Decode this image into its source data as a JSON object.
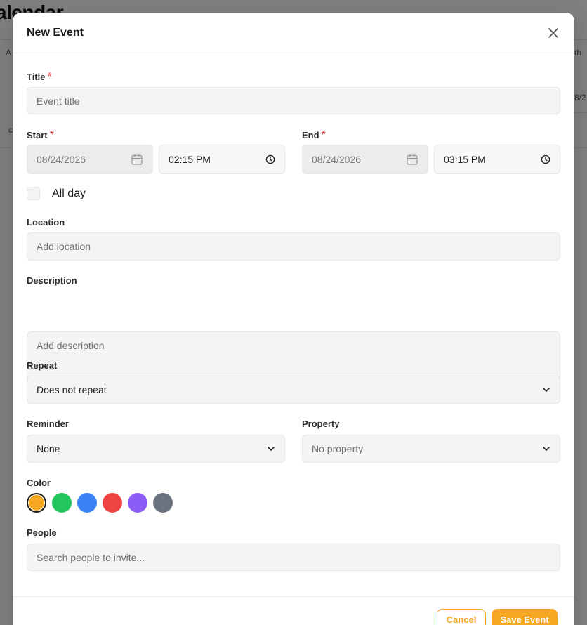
{
  "background": {
    "title_fragment": "alendar",
    "frag_a": "A",
    "frag_th": "th",
    "frag_date": "8/2",
    "frag_c": "c"
  },
  "modal": {
    "title": "New Event",
    "close_icon": "close-icon",
    "title_field": {
      "label": "Title",
      "required_mark": "*",
      "placeholder": "Event title"
    },
    "start": {
      "label": "Start",
      "required_mark": "*",
      "date": "08/24/2026",
      "time": "02:15 PM"
    },
    "end": {
      "label": "End",
      "required_mark": "*",
      "date": "08/24/2026",
      "time": "03:15 PM"
    },
    "all_day": {
      "label": "All day",
      "checked": false
    },
    "location": {
      "label": "Location",
      "placeholder": "Add location"
    },
    "description": {
      "label": "Description",
      "placeholder": "Add description"
    },
    "repeat": {
      "label": "Repeat",
      "selected": "Does not repeat"
    },
    "reminder": {
      "label": "Reminder",
      "selected": "None"
    },
    "property": {
      "label": "Property",
      "selected": "No property"
    },
    "color": {
      "label": "Color",
      "swatches": [
        "#f5a623",
        "#22c55e",
        "#3b82f6",
        "#ef4444",
        "#8b5cf6",
        "#6b7280"
      ],
      "selected_index": 0
    },
    "people": {
      "label": "People",
      "placeholder": "Search people to invite..."
    },
    "footer": {
      "cancel_label": "Cancel",
      "save_label": "Save Event"
    }
  },
  "colors": {
    "accent": "#f5a623",
    "required": "#e0342f"
  }
}
